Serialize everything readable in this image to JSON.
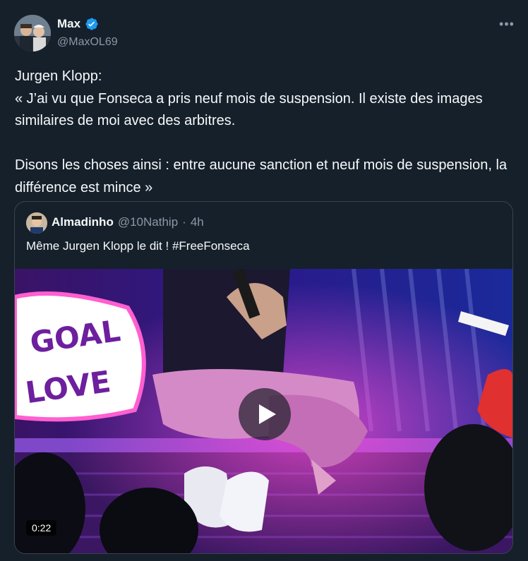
{
  "author": {
    "name": "Max",
    "handle": "@MaxOL69",
    "verified_color": "#1d9bf0"
  },
  "more_icon": "more-horizontal-icon",
  "tweet_text": "Jurgen Klopp:\n« J’ai vu que Fonseca a pris neuf mois de suspension. Il existe des images similaires de moi avec des arbitres.\n\nDisons les choses ainsi : entre aucune sanction et neuf mois de suspension, la différence est mince »",
  "quoted": {
    "name": "Almadinho",
    "handle": "@10Nathip",
    "separator": "·",
    "time": "4h",
    "text": "Même Jurgen Klopp le dit ! #FreeFonseca",
    "video": {
      "duration": "0:22",
      "sign_text": [
        "GOAL",
        "LOVE"
      ],
      "play_icon": "play-icon"
    }
  },
  "colors": {
    "background": "#15202b",
    "text": "#f7f9f9",
    "secondary": "#8b98a5",
    "border": "#38444d",
    "accent": "#1d9bf0"
  }
}
